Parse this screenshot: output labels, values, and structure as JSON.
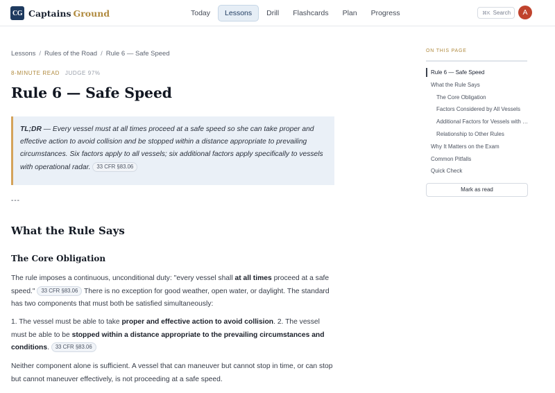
{
  "brand": {
    "logo": "CG",
    "name": "Captains",
    "accent": "Ground"
  },
  "nav": {
    "items": [
      "Today",
      "Lessons",
      "Drill",
      "Flashcards",
      "Plan",
      "Progress"
    ],
    "active": "Lessons"
  },
  "search": {
    "shortcut": "⌘K",
    "label": "Search"
  },
  "user": {
    "initial": "A"
  },
  "breadcrumb": [
    "Lessons",
    "Rules of the Road",
    "Rule 6 — Safe Speed"
  ],
  "meta": {
    "read_time": "8-MINUTE READ",
    "judge": "JUDGE 97%"
  },
  "title": "Rule 6 — Safe Speed",
  "tldr": {
    "label": "TL;DR",
    "text": " — Every vessel must at all times proceed at a safe speed so she can take proper and effective action to avoid collision and be stopped within a distance appropriate to prevailing circumstances. Six factors apply to all vessels; six additional factors apply specifically to vessels with operational radar.",
    "cite": "33 CFR §83.06"
  },
  "separator": "---",
  "section_heading": "What the Rule Says",
  "subsection_heading": "The Core Obligation",
  "paragraphs": {
    "p1_a": "The rule imposes a continuous, unconditional duty: \"every vessel shall ",
    "p1_bold": "at all times",
    "p1_b": " proceed at a safe speed.\"",
    "p1_cite": "33 CFR §83.06",
    "p1_c": " There is no exception for good weather, open water, or daylight. The standard has two components that must both be satisfied simultaneously:",
    "p2_a": "1. The vessel must be able to take ",
    "p2_bold1": "proper and effective action to avoid collision",
    "p2_b": ". 2. The vessel must be able to be ",
    "p2_bold2": "stopped within a distance appropriate to the prevailing circumstances and conditions",
    "p2_c": ".",
    "p2_cite": "33 CFR §83.06",
    "p3": "Neither component alone is sufficient. A vessel that can maneuver but cannot stop in time, or can stop but cannot maneuver effectively, is not proceeding at a safe speed."
  },
  "toc": {
    "title": "ON THIS PAGE",
    "items": [
      "Rule 6 — Safe Speed",
      "What the Rule Says",
      "The Core Obligation",
      "Factors Considered by All Vessels",
      "Additional Factors for Vessels with Radar",
      "Relationship to Other Rules",
      "Why It Matters on the Exam",
      "Common Pitfalls",
      "Quick Check"
    ],
    "mark_read": "Mark as read"
  },
  "colors": {
    "brand_navy": "#1e3a5f",
    "accent_gold": "#b08a3e",
    "avatar": "#c0432d",
    "tldr_bg": "#eaf0f7"
  }
}
